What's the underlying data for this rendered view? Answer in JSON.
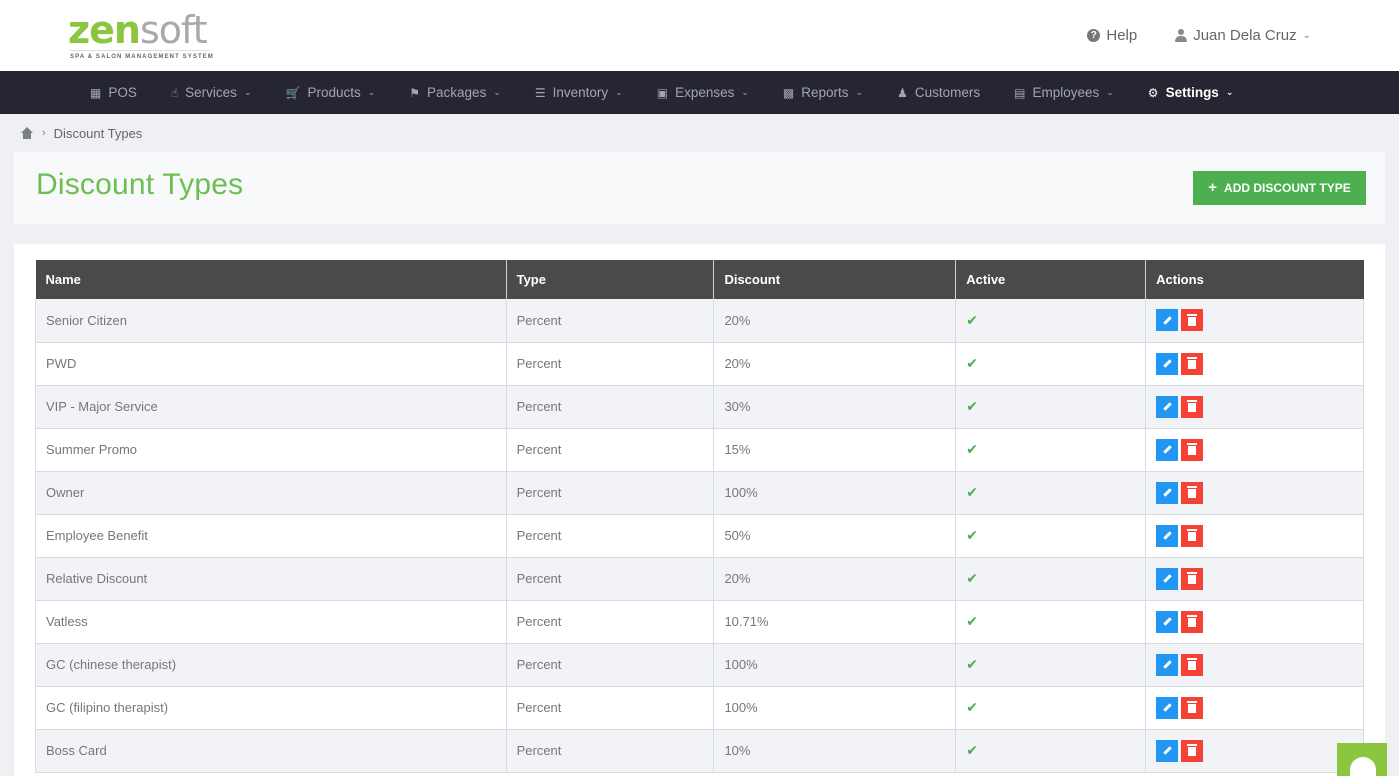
{
  "brand": {
    "name_part1": "zen",
    "name_part2": "soft",
    "tagline": "SPA & SALON MANAGEMENT SYSTEM"
  },
  "header": {
    "help_label": "Help",
    "user_name": "Juan Dela Cruz"
  },
  "nav": {
    "items": [
      {
        "label": "POS",
        "icon": "calculator-icon",
        "dropdown": false
      },
      {
        "label": "Services",
        "icon": "hand-icon",
        "dropdown": true
      },
      {
        "label": "Products",
        "icon": "cart-icon",
        "dropdown": true
      },
      {
        "label": "Packages",
        "icon": "tags-icon",
        "dropdown": true
      },
      {
        "label": "Inventory",
        "icon": "list-icon",
        "dropdown": true
      },
      {
        "label": "Expenses",
        "icon": "receipt-icon",
        "dropdown": true
      },
      {
        "label": "Reports",
        "icon": "bar-chart-icon",
        "dropdown": true
      },
      {
        "label": "Customers",
        "icon": "users-icon",
        "dropdown": false
      },
      {
        "label": "Employees",
        "icon": "briefcase-icon",
        "dropdown": true
      },
      {
        "label": "Settings",
        "icon": "gear-icon",
        "dropdown": true,
        "active": true
      }
    ]
  },
  "breadcrumb": {
    "current": "Discount Types"
  },
  "page": {
    "title": "Discount Types",
    "add_button_label": "ADD DISCOUNT TYPE"
  },
  "table": {
    "headers": [
      "Name",
      "Type",
      "Discount",
      "Active",
      "Actions"
    ],
    "rows": [
      {
        "name": "Senior Citizen",
        "type": "Percent",
        "discount": "20%",
        "active": true
      },
      {
        "name": "PWD",
        "type": "Percent",
        "discount": "20%",
        "active": true
      },
      {
        "name": "VIP - Major Service",
        "type": "Percent",
        "discount": "30%",
        "active": true
      },
      {
        "name": "Summer Promo",
        "type": "Percent",
        "discount": "15%",
        "active": true
      },
      {
        "name": "Owner",
        "type": "Percent",
        "discount": "100%",
        "active": true
      },
      {
        "name": "Employee Benefit",
        "type": "Percent",
        "discount": "50%",
        "active": true
      },
      {
        "name": "Relative Discount",
        "type": "Percent",
        "discount": "20%",
        "active": true
      },
      {
        "name": "Vatless",
        "type": "Percent",
        "discount": "10.71%",
        "active": true
      },
      {
        "name": "GC (chinese therapist)",
        "type": "Percent",
        "discount": "100%",
        "active": true
      },
      {
        "name": "GC (filipino therapist)",
        "type": "Percent",
        "discount": "100%",
        "active": true
      },
      {
        "name": "Boss Card",
        "type": "Percent",
        "discount": "10%",
        "active": true
      }
    ]
  },
  "colors": {
    "accent_green": "#6cbf52",
    "button_green": "#4caf50",
    "nav_bg": "#262633",
    "edit_blue": "#2196f3",
    "delete_red": "#f44336"
  }
}
